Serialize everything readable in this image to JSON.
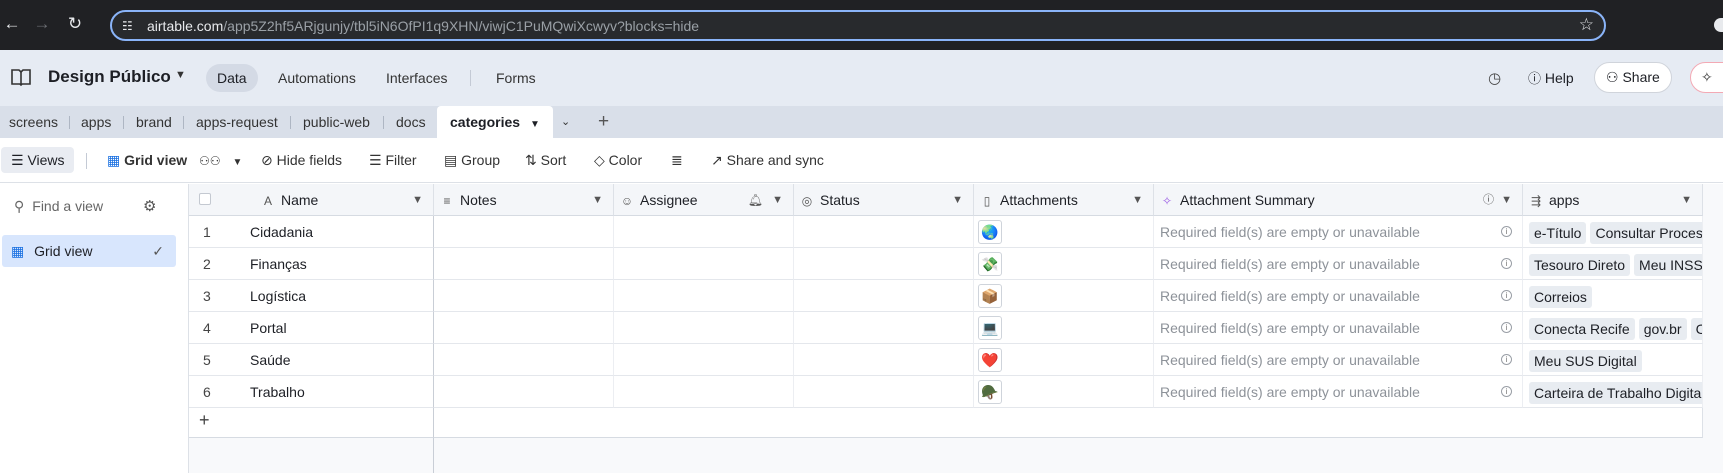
{
  "browser": {
    "url_host": "airtable.com",
    "url_path": "/app5Z2hf5ARjgunjy/tbl5iN6OfPI1q9XHN/viwjC1PuMQwiXcwyv?blocks=hide",
    "icons": [
      "back-icon",
      "forward-icon",
      "reload-icon",
      "site-settings-icon",
      "bookmark-star-icon"
    ]
  },
  "header": {
    "base_name": "Design Público",
    "nav": [
      "Data",
      "Automations",
      "Interfaces",
      "Forms"
    ],
    "active_nav": "Data",
    "help_label": "Help",
    "share_label": "Share"
  },
  "tables": {
    "tabs": [
      "screens",
      "apps",
      "brand",
      "apps-request",
      "public-web",
      "docs",
      "categories"
    ],
    "active": "categories"
  },
  "viewbar": {
    "views_label": "Views",
    "view_name": "Grid view",
    "hide_fields": "Hide fields",
    "filter": "Filter",
    "group": "Group",
    "sort": "Sort",
    "color": "Color",
    "share_sync": "Share and sync"
  },
  "sidebar": {
    "find_placeholder": "Find a view",
    "views": [
      "Grid view"
    ]
  },
  "grid": {
    "columns": [
      "Name",
      "Notes",
      "Assignee",
      "Status",
      "Attachments",
      "Attachment Summary",
      "apps"
    ],
    "summary_text": "Required field(s) are empty or unavailable",
    "rows": [
      {
        "num": "1",
        "name": "Cidadania",
        "attachment": "🌏",
        "apps": [
          "e-Título",
          "Consultar Processo"
        ]
      },
      {
        "num": "2",
        "name": "Finanças",
        "attachment": "💸",
        "apps": [
          "Tesouro Direto",
          "Meu INSS"
        ]
      },
      {
        "num": "3",
        "name": "Logística",
        "attachment": "📦",
        "apps": [
          "Correios"
        ]
      },
      {
        "num": "4",
        "name": "Portal",
        "attachment": "💻",
        "apps": [
          "Conecta Recife",
          "gov.br",
          "Ca"
        ]
      },
      {
        "num": "5",
        "name": "Saúde",
        "attachment": "❤️",
        "apps": [
          "Meu SUS Digital"
        ]
      },
      {
        "num": "6",
        "name": "Trabalho",
        "attachment": "🪖",
        "apps": [
          "Carteira de Trabalho Digital"
        ]
      }
    ],
    "add_row": "+"
  }
}
